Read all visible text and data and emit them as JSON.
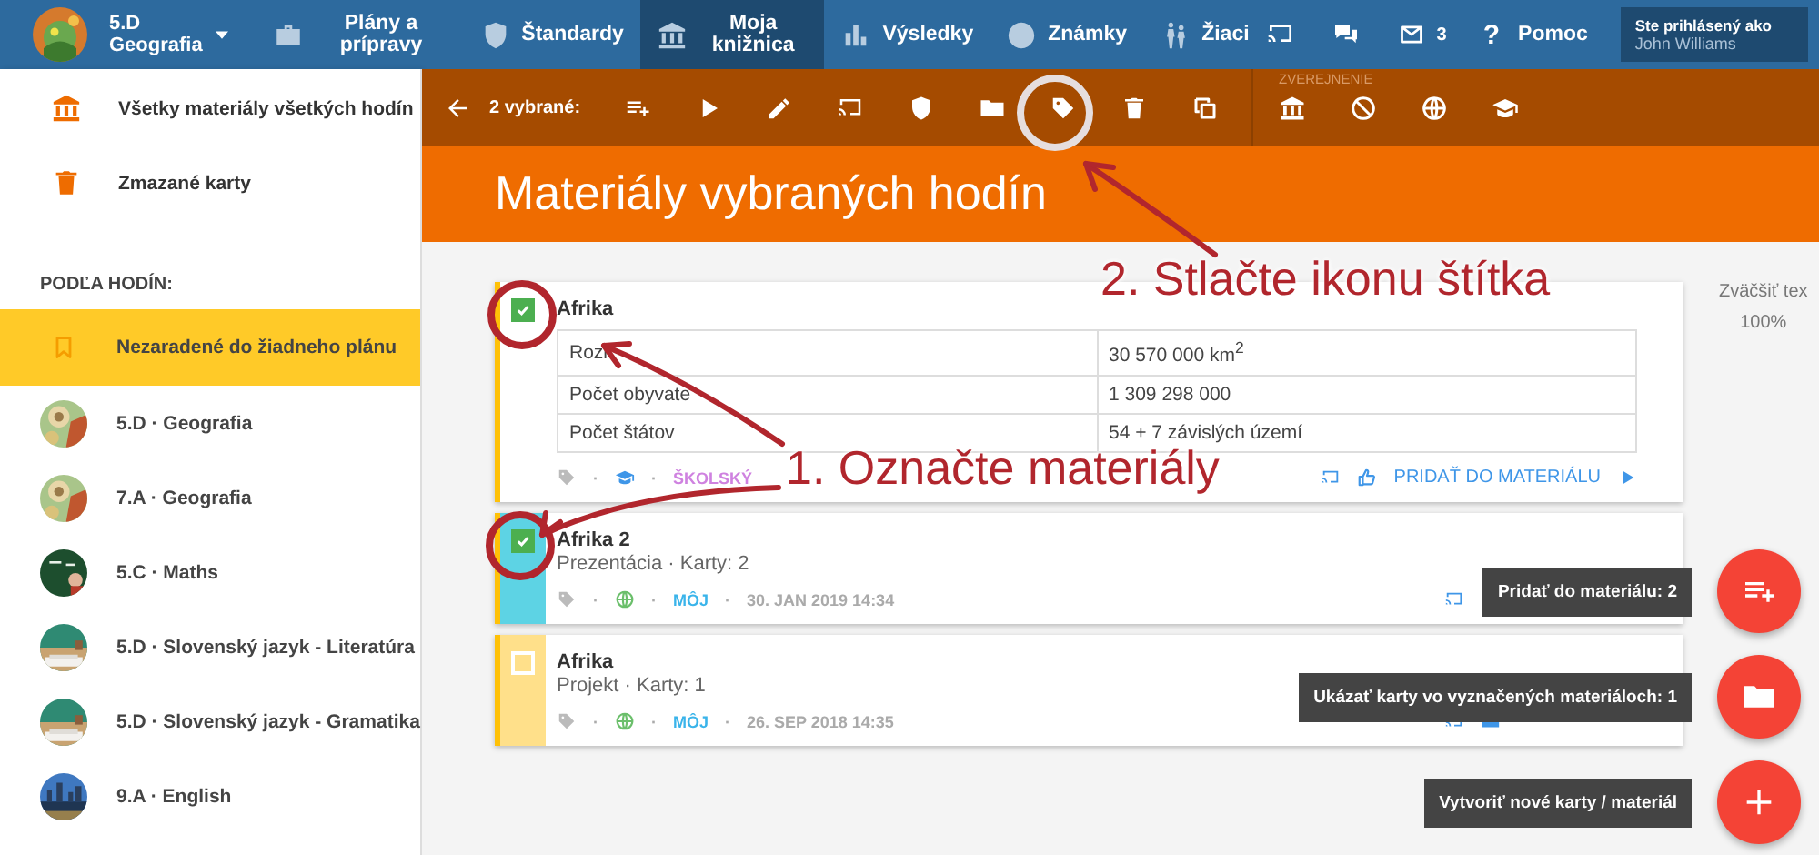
{
  "top_bar": {
    "class_switcher": {
      "code": "5.D",
      "subject": "Geografia"
    },
    "nav": [
      {
        "kind": "plans",
        "label": "Plány a prípravy",
        "selected": false
      },
      {
        "kind": "standards",
        "label": "Štandardy",
        "selected": false
      },
      {
        "kind": "library",
        "label": "Moja knižnica",
        "selected": true
      },
      {
        "kind": "results",
        "label": "Výsledky",
        "selected": false
      },
      {
        "kind": "grades",
        "label": "Známky",
        "selected": false
      },
      {
        "kind": "students",
        "label": "Žiaci",
        "selected": false
      }
    ],
    "messages_count": "3",
    "help": {
      "icon": "?",
      "label": "Pomoc"
    },
    "user": {
      "caption": "Ste prihlásený ako",
      "name": "John Williams"
    }
  },
  "sidebar": {
    "items": [
      {
        "kind": "library",
        "label": "Všetky materiály všetkých hodín"
      },
      {
        "kind": "trash",
        "label": "Zmazané karty"
      }
    ],
    "section_title": "PODĽA HODÍN:",
    "lessons": [
      {
        "kind": "unassigned",
        "label": "Nezaradené do žiadneho plánu",
        "selected": true
      },
      {
        "kind": "picture",
        "label": "5.D · Geografia",
        "selected": false
      },
      {
        "kind": "picture",
        "label": "7.A · Geografia",
        "selected": false
      },
      {
        "kind": "picture",
        "label": "5.C · Maths",
        "selected": false
      },
      {
        "kind": "picture",
        "label": "5.D · Slovenský jazyk - Literatúra",
        "selected": false
      },
      {
        "kind": "picture",
        "label": "5.D · Slovenský jazyk - Gramatika",
        "selected": false
      },
      {
        "kind": "picture",
        "label": "9.A · English",
        "selected": false
      }
    ]
  },
  "toolbar": {
    "selection": "2 vybrané:",
    "section_label": "ZVEREJNENIE"
  },
  "page_title": "Materiály vybraných hodín",
  "text_size": {
    "label": "Zväčšiť tex",
    "value": "100%"
  },
  "cards": [
    {
      "title": "Afrika",
      "checked": true,
      "color": "#ffffff",
      "table": [
        [
          "Rozl",
          "30 570 000 km$^{2}$"
        ],
        [
          "Počet obyvate",
          "1 309 298 000"
        ],
        [
          "Počet štátov",
          "54 + 7 závislých území"
        ]
      ],
      "footer": {
        "kind": "school",
        "separator": "·",
        "scope": "ŠKOLSKÝ",
        "action": "PRIDAŤ DO MATERIÁLU"
      }
    },
    {
      "title": "Afrika 2",
      "checked": true,
      "color": "#5dd3e4",
      "subtitle": "Prezentácia · Karty: 2",
      "footer": {
        "kind": "public",
        "separator": "·",
        "scope": "MÔJ",
        "date": "30. JAN 2019 14:34"
      }
    },
    {
      "title": "Afrika",
      "checked": false,
      "color": "#ffe08a",
      "subtitle": "Projekt · Karty: 1",
      "footer": {
        "kind": "public",
        "separator": "·",
        "scope": "MÔJ",
        "date": "26. SEP 2018 14:35"
      }
    }
  ],
  "fabs": [
    {
      "kind": "add-to-list",
      "tooltip": "Pridať do materiálu: 2"
    },
    {
      "kind": "folder",
      "tooltip": "Ukázať karty vo vyznačených materiáloch: 1"
    },
    {
      "kind": "plus",
      "tooltip": "Vytvoriť nové karty / materiál"
    }
  ],
  "annotations": [
    {
      "text": "2. Stlačte ikonu štítka"
    },
    {
      "text": "1. Označte materiály"
    }
  ]
}
